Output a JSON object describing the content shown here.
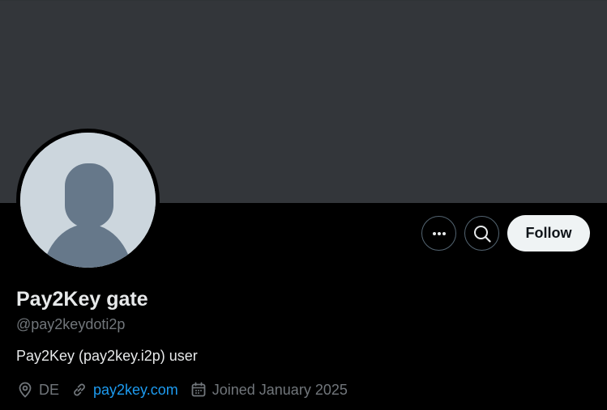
{
  "profile": {
    "display_name": "Pay2Key gate",
    "handle": "@pay2keydoti2p",
    "bio": "Pay2Key (pay2key.i2p) user",
    "location": "DE",
    "website": "pay2key.com",
    "joined": "Joined January 2025"
  },
  "actions": {
    "more_icon": "more-horizontal-icon",
    "search_icon": "search-icon",
    "follow_label": "Follow"
  },
  "icons": {
    "location": "location-pin-icon",
    "link": "link-icon",
    "calendar": "calendar-icon"
  },
  "colors": {
    "background": "#000000",
    "banner": "#33363a",
    "avatar_bg": "#ccd6dd",
    "avatar_silhouette": "#66788a",
    "text_primary": "#e7e9ea",
    "text_secondary": "#71767b",
    "link": "#1d9bf0",
    "follow_button_bg": "#eff3f4",
    "follow_button_text": "#0f1419"
  }
}
